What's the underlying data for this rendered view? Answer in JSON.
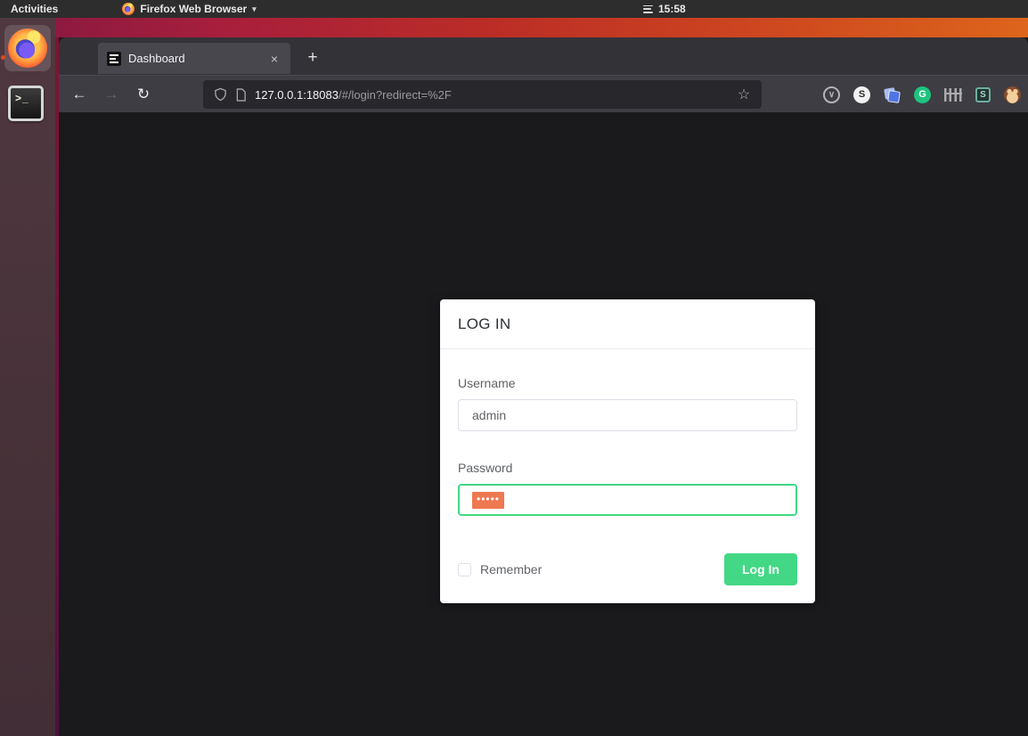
{
  "system_bar": {
    "activities_label": "Activities",
    "app_menu_label": "Firefox Web Browser",
    "menu_caret": "▾",
    "clock_time": "15:58"
  },
  "dock": {
    "terminal_glyph": ">_"
  },
  "browser": {
    "tab_title": "Dashboard",
    "tab_close_glyph": "×",
    "new_tab_glyph": "+",
    "nav": {
      "back_glyph": "←",
      "forward_glyph": "→",
      "reload_glyph": "↻",
      "star_glyph": "☆"
    },
    "url_host": "127.0.0.1:18083",
    "url_path": "/#/login?redirect=%2F",
    "extensions": [
      {
        "name": "pocket-icon",
        "glyph": "∨"
      },
      {
        "name": "s-badge-icon",
        "glyph": "S"
      },
      {
        "name": "sticky-notes-icon",
        "glyph": ""
      },
      {
        "name": "grammarly-icon",
        "glyph": "G"
      },
      {
        "name": "fence-icon",
        "glyph": ""
      },
      {
        "name": "stylus-icon",
        "glyph": "S"
      },
      {
        "name": "monkey-icon",
        "glyph": ""
      }
    ]
  },
  "login_page": {
    "card_title": "LOG IN",
    "username": {
      "label": "Username",
      "value": "admin"
    },
    "password": {
      "label": "Password",
      "masked_value": "•••••"
    },
    "remember_label": "Remember",
    "login_button_label": "Log In"
  },
  "colors": {
    "accent_green": "#42d885",
    "selection_orange": "#ee7850",
    "ubuntu_orange": "#e0491e",
    "page_background": "#1a191c"
  }
}
